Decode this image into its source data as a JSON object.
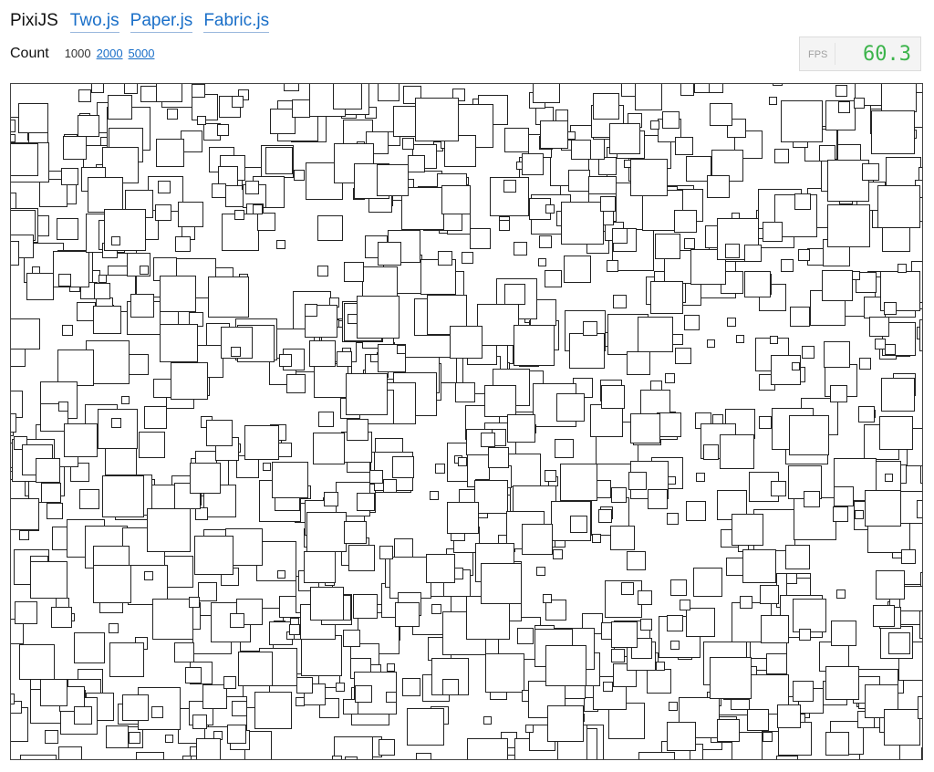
{
  "nav": {
    "current": "PixiJS",
    "links": [
      "Two.js",
      "Paper.js",
      "Fabric.js"
    ]
  },
  "count": {
    "label": "Count",
    "current": "1000",
    "options": [
      "2000",
      "5000"
    ]
  },
  "fps": {
    "label": "FPS",
    "value": "60.3",
    "value_color": "#3cb44b"
  },
  "colors": {
    "link": "#1a6fc8",
    "square_fill": "#ffffff",
    "square_stroke": "#222222"
  }
}
